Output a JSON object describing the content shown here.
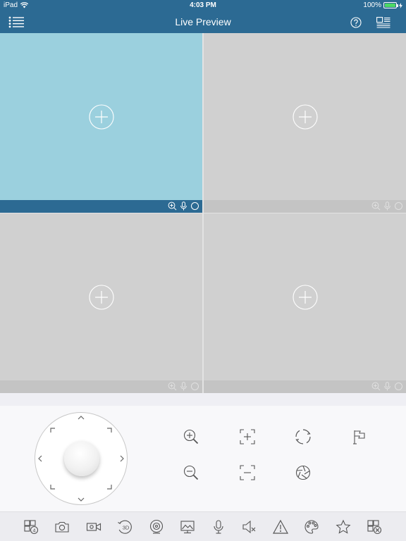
{
  "status_bar": {
    "device": "iPad",
    "time": "4:03 PM",
    "battery": "100%"
  },
  "nav": {
    "title": "Live Preview",
    "icons": [
      "menu-list-icon",
      "help-icon",
      "layout-icon"
    ]
  },
  "grid": {
    "selected_window": 1,
    "windows": [
      {
        "id": 1,
        "icons": [
          "digital-zoom-icon",
          "microphone-icon",
          "record-circle-icon"
        ]
      },
      {
        "id": 2,
        "icons": [
          "digital-zoom-icon",
          "microphone-icon",
          "record-circle-icon"
        ]
      },
      {
        "id": 3,
        "icons": [
          "digital-zoom-icon",
          "microphone-icon",
          "record-circle-icon"
        ]
      },
      {
        "id": 4,
        "icons": [
          "digital-zoom-icon",
          "microphone-icon",
          "record-circle-icon"
        ]
      }
    ]
  },
  "ptz_controls": {
    "icons": [
      "zoom-in-icon",
      "focus-near-icon",
      "iris-open-icon",
      "preset-flag-icon",
      "zoom-out-icon",
      "focus-far-icon",
      "iris-close-icon"
    ]
  },
  "toolbar": {
    "icons": [
      "split-window-icon",
      "snapshot-camera-icon",
      "record-video-icon",
      "3d-positioning-icon",
      "fisheye-icon",
      "image-adjust-icon",
      "talk-microphone-icon",
      "mute-speaker-icon",
      "alarm-warning-icon",
      "color-palette-icon",
      "favorite-star-icon",
      "close-all-windows-icon"
    ]
  },
  "colors": {
    "header": "#2c6a93",
    "selected_window": "#9bd0de",
    "idle_window": "#d0d0d0",
    "icon_stroke": "#555555"
  }
}
